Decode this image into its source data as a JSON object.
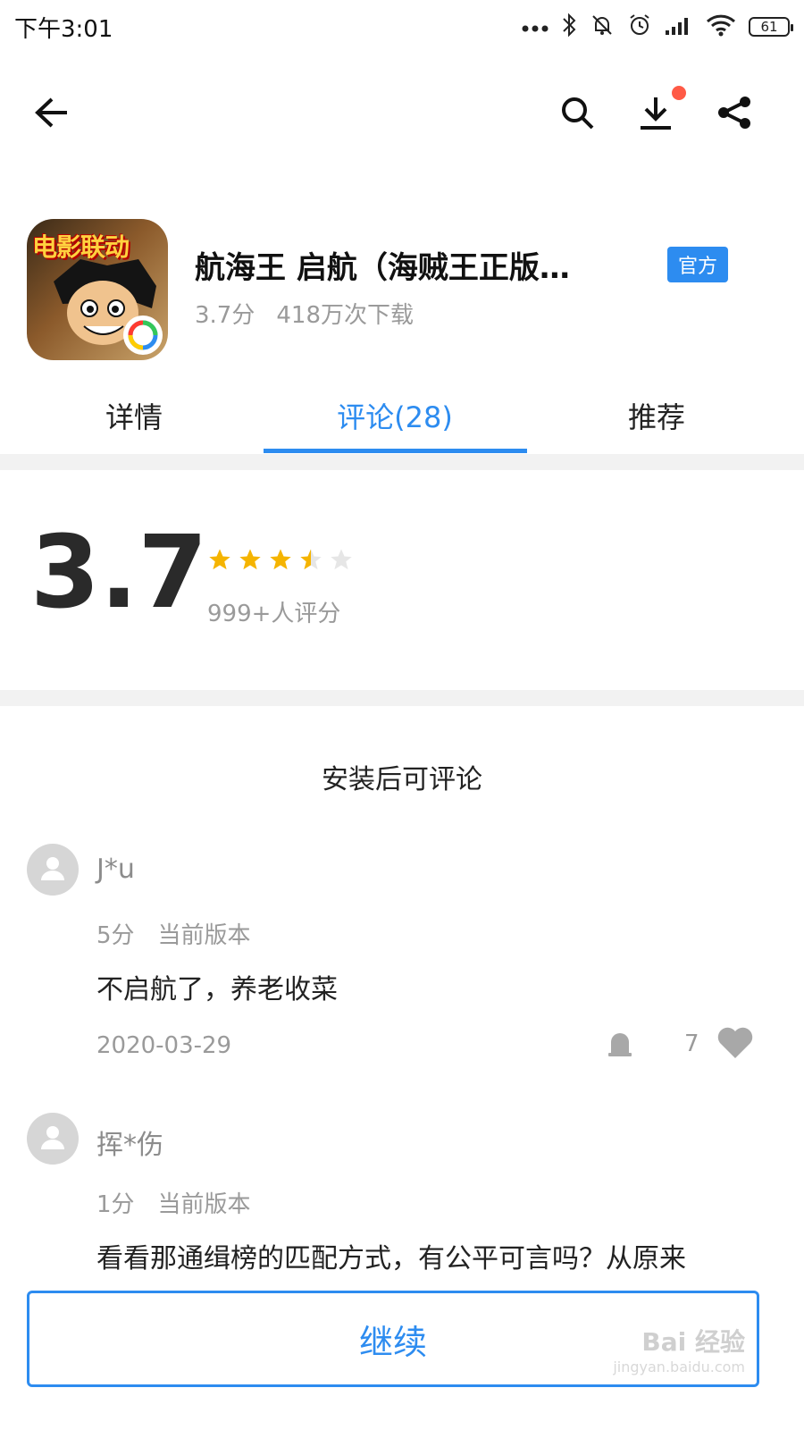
{
  "status_bar": {
    "time": "下午3:01",
    "battery": "61"
  },
  "toolbar": {
    "back": "back-arrow-icon",
    "search": "search-icon",
    "download": "download-icon",
    "share": "share-icon",
    "download_badge_color": "#ff5a46"
  },
  "app": {
    "icon_text": "电影联动",
    "title": "航海王 启航（海贼王正版…",
    "official_badge": "官方",
    "score_text": "3.7分",
    "downloads": "418万次下载"
  },
  "tabs": [
    {
      "label": "详情",
      "active": false
    },
    {
      "label": "评论(28)",
      "active": true
    },
    {
      "label": "推荐",
      "active": false
    }
  ],
  "rating": {
    "score": "3.7",
    "stars": 3.5,
    "count_text": "999+人评分",
    "star_color": "#f5b400"
  },
  "install_tip": "安装后可评论",
  "reviews": [
    {
      "user": "J*u",
      "score": "5分",
      "version": "当前版本",
      "text": "不启航了，养老收菜",
      "date": "2020-03-29",
      "likes": "7"
    },
    {
      "user": "挥*伤",
      "score": "1分",
      "version": "当前版本",
      "text": "看看那通缉榜的匹配方式，有公平可言吗？从原来"
    }
  ],
  "bottom": {
    "continue_label": "继续"
  },
  "watermark": {
    "text": "Bai 经验",
    "sub": "jingyan.baidu.com"
  },
  "colors": {
    "accent": "#2d8cf0"
  }
}
